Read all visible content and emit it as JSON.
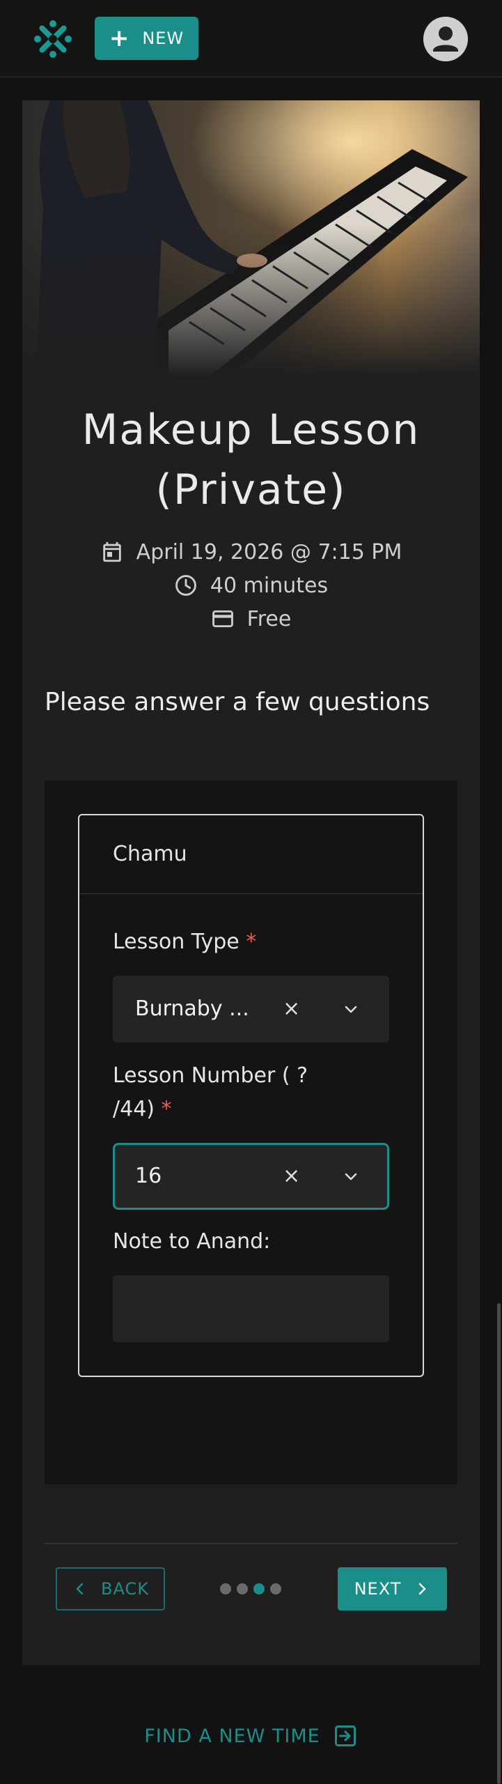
{
  "topbar": {
    "new_button_label": "NEW",
    "logo_icon": "teal-x-flower-logo",
    "avatar_icon": "user-avatar-icon"
  },
  "lesson": {
    "title_line1": "Makeup Lesson",
    "title_line2": "(Private)",
    "date": "April 19, 2026 @ 7:15 PM",
    "duration": "40 minutes",
    "price": "Free",
    "hero_image": "person playing piano photo"
  },
  "questions": {
    "heading": "Please answer a few questions",
    "form_name": "Chamu",
    "lesson_type": {
      "label": "Lesson Type",
      "required_mark": "*",
      "value": "Burnaby ...",
      "clear_icon": "×"
    },
    "lesson_number": {
      "label_line1": "Lesson Number ( ?",
      "label_line2": "/44)",
      "required_mark": "*",
      "value": "16",
      "clear_icon": "×"
    },
    "note": {
      "label": "Note to Anand:",
      "value": ""
    }
  },
  "navigation": {
    "back_label": "BACK",
    "next_label": "NEXT",
    "steps_total": 4,
    "current_step": 3
  },
  "find_new_time_label": "FIND A NEW TIME",
  "colors": {
    "accent": "#1a8f8a",
    "background": "#121212",
    "card": "#1f1f1f",
    "required": "#e35d5d"
  }
}
